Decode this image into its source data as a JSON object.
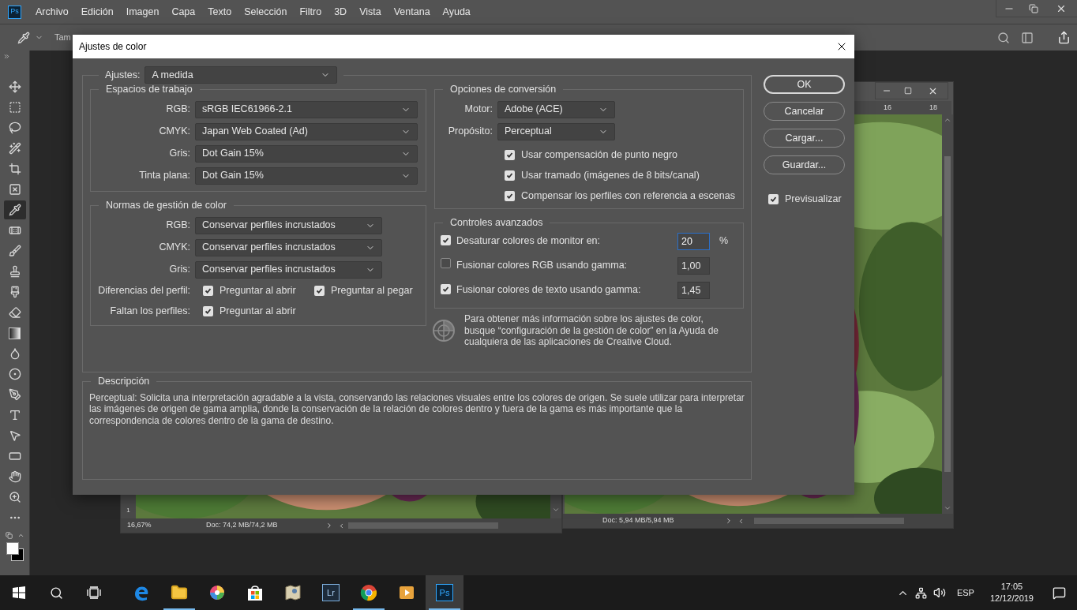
{
  "app": {
    "logo": "Ps",
    "menu": [
      "Archivo",
      "Edición",
      "Imagen",
      "Capa",
      "Texto",
      "Selección",
      "Filtro",
      "3D",
      "Vista",
      "Ventana",
      "Ayuda"
    ],
    "options_label": "Tam"
  },
  "tools": [
    {
      "kind": "move",
      "selected": false
    },
    {
      "kind": "marquee",
      "selected": false
    },
    {
      "kind": "lasso",
      "selected": false
    },
    {
      "kind": "quick-select",
      "selected": false
    },
    {
      "kind": "crop",
      "selected": false
    },
    {
      "kind": "frame",
      "selected": false
    },
    {
      "kind": "eyedropper",
      "selected": true
    },
    {
      "kind": "healing",
      "selected": false
    },
    {
      "kind": "brush",
      "selected": false
    },
    {
      "kind": "stamp",
      "selected": false
    },
    {
      "kind": "history-brush",
      "selected": false
    },
    {
      "kind": "eraser",
      "selected": false
    },
    {
      "kind": "gradient",
      "selected": false
    },
    {
      "kind": "blur",
      "selected": false
    },
    {
      "kind": "dodge",
      "selected": false
    },
    {
      "kind": "pen",
      "selected": false
    },
    {
      "kind": "type",
      "selected": false
    },
    {
      "kind": "path-select",
      "selected": false
    },
    {
      "kind": "rectangle",
      "selected": false
    },
    {
      "kind": "rotate-view",
      "selected": false
    },
    {
      "kind": "zoom",
      "selected": false
    },
    {
      "kind": "more",
      "selected": false
    }
  ],
  "documents": [
    {
      "zoom": "16,67%",
      "doc_info": "Doc: 74,2 MB/74,2 MB",
      "ruler": [
        "1"
      ]
    },
    {
      "doc_info": "Doc: 5,94 MB/5,94 MB",
      "ruler": [
        "16",
        "18"
      ]
    }
  ],
  "dialog": {
    "title": "Ajustes de color",
    "preset": {
      "label": "Ajustes:",
      "value": "A medida"
    },
    "working_spaces": {
      "title": "Espacios de trabajo",
      "rows": [
        {
          "label": "RGB:",
          "value": "sRGB IEC61966-2.1"
        },
        {
          "label": "CMYK:",
          "value": "Japan Web Coated (Ad)"
        },
        {
          "label": "Gris:",
          "value": "Dot Gain 15%"
        },
        {
          "label": "Tinta plana:",
          "value": "Dot Gain 15%"
        }
      ]
    },
    "policies": {
      "title": "Normas de gestión de color",
      "rows": [
        {
          "label": "RGB:",
          "value": "Conservar perfiles incrustados"
        },
        {
          "label": "CMYK:",
          "value": "Conservar perfiles incrustados"
        },
        {
          "label": "Gris:",
          "value": "Conservar perfiles incrustados"
        }
      ],
      "checks": [
        {
          "label": "Diferencias del perfil:",
          "options": [
            {
              "label": "Preguntar al abrir",
              "checked": true
            },
            {
              "label": "Preguntar al pegar",
              "checked": true
            }
          ]
        },
        {
          "label": "Faltan los perfiles:",
          "options": [
            {
              "label": "Preguntar al abrir",
              "checked": true
            }
          ]
        }
      ]
    },
    "conversion": {
      "title": "Opciones de conversión",
      "rows": [
        {
          "label": "Motor:",
          "value": "Adobe (ACE)"
        },
        {
          "label": "Propósito:",
          "value": "Perceptual"
        }
      ],
      "options": [
        {
          "label": "Usar compensación de punto negro",
          "checked": true
        },
        {
          "label": "Usar tramado (imágenes de 8 bits/canal)",
          "checked": true
        },
        {
          "label": "Compensar los perfiles con referencia a escenas",
          "checked": true
        }
      ]
    },
    "advanced": {
      "title": "Controles avanzados",
      "rows": [
        {
          "label": "Desaturar colores de monitor en:",
          "checked": true,
          "value": "20",
          "unit": "%",
          "focused": true
        },
        {
          "label": "Fusionar colores RGB usando gamma:",
          "checked": false,
          "value": "1,00",
          "focused": false
        },
        {
          "label": "Fusionar colores de texto usando gamma:",
          "checked": true,
          "value": "1,45",
          "focused": false
        }
      ]
    },
    "info": "Para obtener más información sobre los ajustes de color, busque “configuración de la gestión de color” en la Ayuda de cualquiera de las aplicaciones de Creative Cloud.",
    "description": {
      "title": "Descripción",
      "text": "Perceptual: Solicita una interpretación agradable a la vista, conservando las relaciones visuales entre los colores de origen. Se suele utilizar para interpretar las imágenes de origen de gama amplia, donde la conservación de la relación de colores dentro y fuera de la gama es más importante que la correspondencia de colores dentro de la gama de destino."
    },
    "buttons": [
      {
        "label": "OK",
        "default": true
      },
      {
        "label": "Cancelar",
        "default": false
      },
      {
        "label": "Cargar...",
        "default": false
      },
      {
        "label": "Guardar...",
        "default": false
      }
    ],
    "preview": {
      "label": "Previsualizar",
      "checked": true
    }
  },
  "taskbar": {
    "apps": [
      {
        "kind": "edge",
        "running": false,
        "selected": false
      },
      {
        "kind": "explorer",
        "running": true,
        "selected": false
      },
      {
        "kind": "color-wheel",
        "running": false,
        "selected": false
      },
      {
        "kind": "store",
        "running": false,
        "selected": false
      },
      {
        "kind": "maps",
        "running": false,
        "selected": false
      },
      {
        "kind": "lightroom",
        "label": "Lr",
        "running": false,
        "selected": false
      },
      {
        "kind": "chrome",
        "running": true,
        "selected": false
      },
      {
        "kind": "media",
        "running": false,
        "selected": false
      },
      {
        "kind": "photoshop",
        "label": "Ps",
        "running": true,
        "selected": true
      }
    ],
    "language": "ESP",
    "time": "17:05",
    "date": "12/12/2019"
  }
}
